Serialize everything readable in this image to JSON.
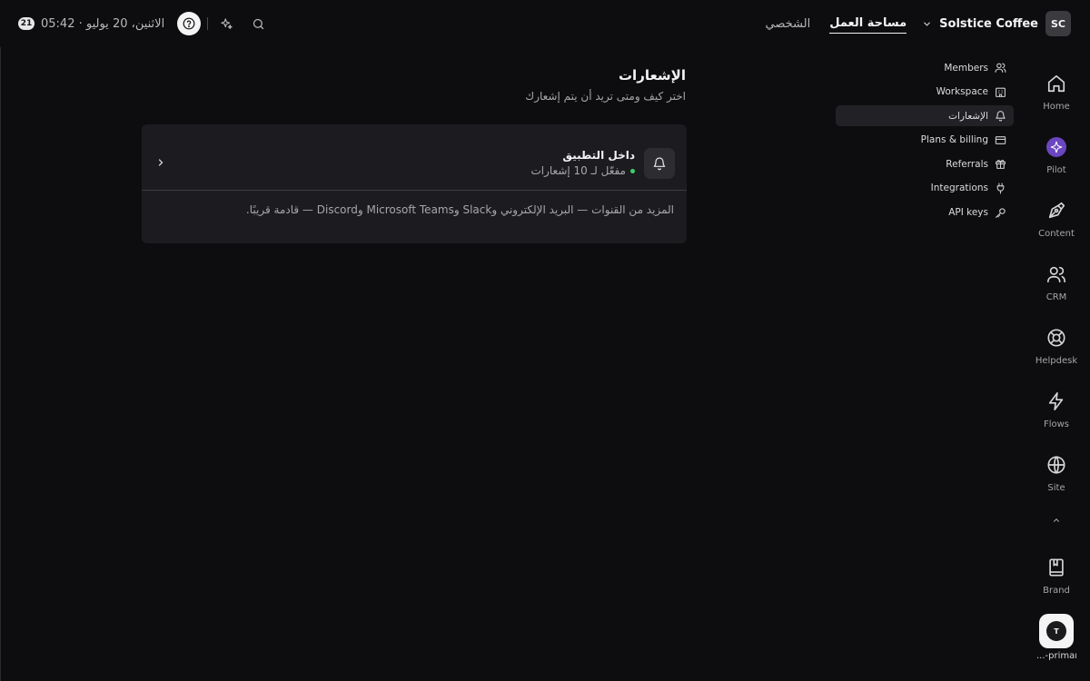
{
  "topbar": {
    "date_badge": "21",
    "date_text": "الاثنين، 20 يوليو  ·  05:42",
    "tab_personal": "الشخصي",
    "tab_workspace": "مساحة العمل",
    "workspace_name": "Solstice Coffee",
    "workspace_initials": "SC"
  },
  "icons": {
    "help": "help-circle-icon",
    "sparkle": "sparkle-icon",
    "search": "search-icon",
    "chevron": "chevron-down-icon"
  },
  "rail": {
    "items": [
      {
        "label": "Home",
        "icon": "home-icon"
      },
      {
        "label": "Pilot",
        "icon": "pilot-icon"
      },
      {
        "label": "Content",
        "icon": "pen-icon"
      },
      {
        "label": "CRM",
        "icon": "users-icon"
      },
      {
        "label": "Helpdesk",
        "icon": "lifebuoy-icon"
      },
      {
        "label": "Flows",
        "icon": "lightning-icon"
      },
      {
        "label": "Site",
        "icon": "globe-icon"
      },
      {
        "label": "Brand",
        "icon": "book-icon"
      }
    ],
    "workspace_switch_initial": "T",
    "workspace_switch_label": "...-primary"
  },
  "settings_nav": {
    "items": [
      {
        "label": "Members",
        "icon": "members-icon",
        "active": false
      },
      {
        "label": "Workspace",
        "icon": "building-icon",
        "active": false
      },
      {
        "label": "الإشعارات",
        "icon": "bell-icon",
        "active": true
      },
      {
        "label": "Plans & billing",
        "icon": "credit-card-icon",
        "active": false
      },
      {
        "label": "Referrals",
        "icon": "gift-icon",
        "active": false
      },
      {
        "label": "Integrations",
        "icon": "plug-icon",
        "active": false
      },
      {
        "label": "API keys",
        "icon": "key-icon",
        "active": false
      }
    ]
  },
  "main": {
    "title": "الإشعارات",
    "subtitle": "اختر كيف ومتى تريد أن يتم إشعارك",
    "card": {
      "row_title": "داخل التطبيق",
      "row_status": "مفعّل لـ 10 إشعارات",
      "status_color": "#3ecf6e",
      "footer": "المزيد من القنوات — البريد الإلكتروني وSlack وMicrosoft Teams وDiscord — قادمة قريبًا."
    }
  }
}
